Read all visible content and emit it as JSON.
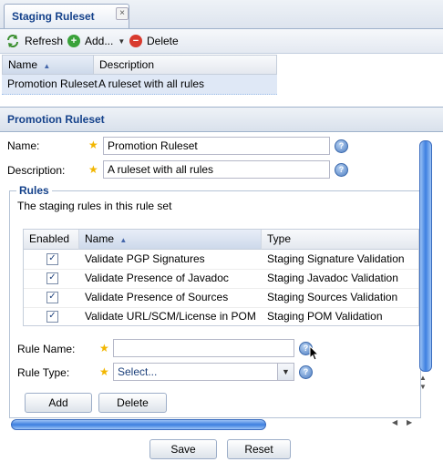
{
  "tab": {
    "title": "Staging Ruleset",
    "close_glyph": "×"
  },
  "toolbar": {
    "refresh": "Refresh",
    "add": "Add...",
    "delete": "Delete"
  },
  "ruleset_grid": {
    "columns": [
      "Name",
      "Description"
    ],
    "rows": [
      {
        "name": "Promotion Ruleset",
        "description": "A ruleset with all rules"
      }
    ]
  },
  "panel": {
    "title": "Promotion Ruleset"
  },
  "form": {
    "name_label": "Name:",
    "name_value": "Promotion Ruleset",
    "description_label": "Description:",
    "description_value": "A ruleset with all rules"
  },
  "rules": {
    "legend": "Rules",
    "caption": "The staging rules in this rule set",
    "columns": [
      "Enabled",
      "Name",
      "Type"
    ],
    "rows": [
      {
        "enabled": true,
        "name": "Validate PGP Signatures",
        "type": "Staging Signature Validation"
      },
      {
        "enabled": true,
        "name": "Validate Presence of Javadoc",
        "type": "Staging Javadoc Validation"
      },
      {
        "enabled": true,
        "name": "Validate Presence of Sources",
        "type": "Staging Sources Validation"
      },
      {
        "enabled": true,
        "name": "Validate URL/SCM/License in POM",
        "type": "Staging POM Validation"
      }
    ],
    "rule_name_label": "Rule Name:",
    "rule_name_value": "",
    "rule_type_label": "Rule Type:",
    "rule_type_value": "Select...",
    "add_button": "Add",
    "delete_button": "Delete"
  },
  "footer": {
    "save": "Save",
    "reset": "Reset"
  },
  "colors": {
    "accent": "#15428b",
    "selection": "#dfe8f6",
    "scroll": "#4d8be8",
    "add_icon": "#3aa23a",
    "delete_icon": "#d83a2e"
  }
}
